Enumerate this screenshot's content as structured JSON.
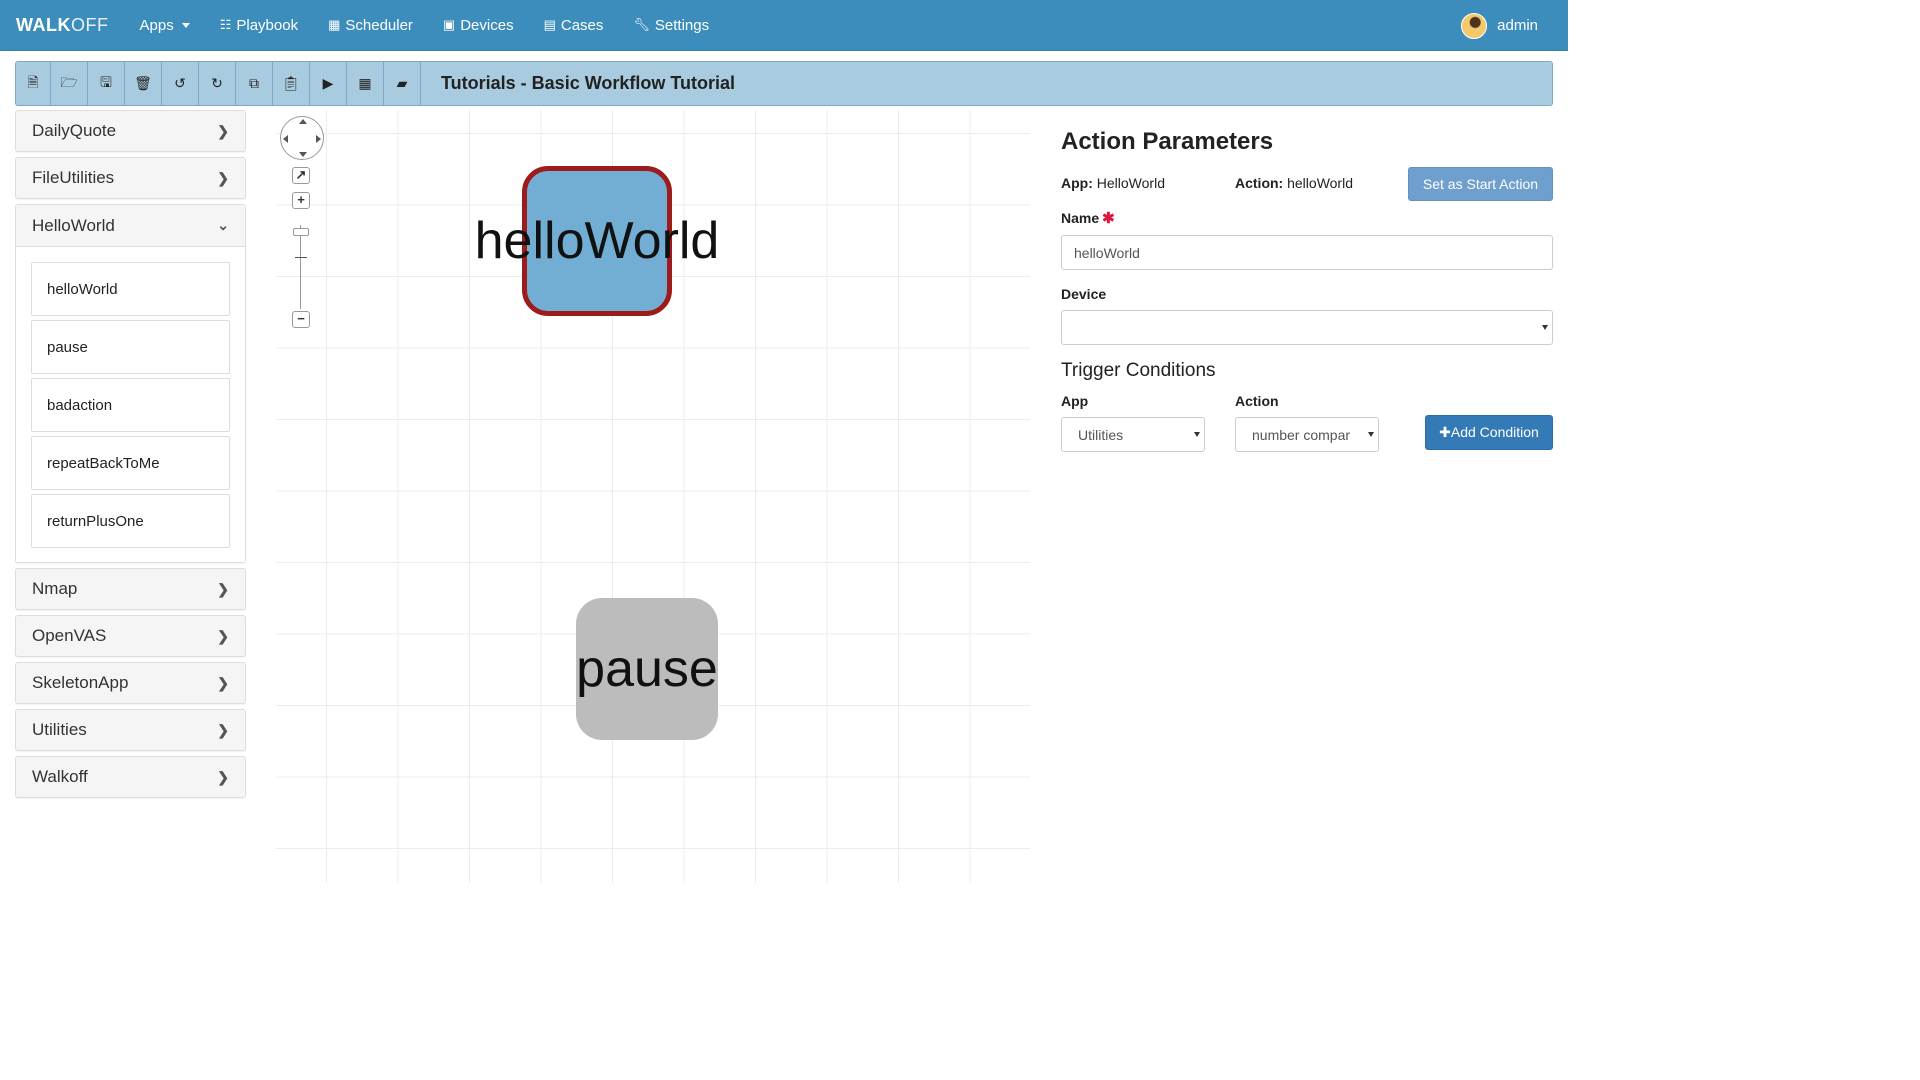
{
  "navbar": {
    "brand_bold": "WALK",
    "brand_light": "OFF",
    "items": [
      {
        "label": "Apps",
        "icon": "none",
        "dropdown": true
      },
      {
        "label": "Playbook",
        "icon": "sitemap-icon"
      },
      {
        "label": "Scheduler",
        "icon": "calendar-icon"
      },
      {
        "label": "Devices",
        "icon": "desktop-icon"
      },
      {
        "label": "Cases",
        "icon": "list-icon"
      },
      {
        "label": "Settings",
        "icon": "wrench-icon"
      }
    ],
    "user": "admin"
  },
  "toolbar": {
    "title": "Tutorials - Basic Workflow Tutorial",
    "buttons": [
      "new-file-icon",
      "open-folder-icon",
      "save-icon",
      "trash-icon",
      "undo-icon",
      "redo-icon",
      "copy-icon",
      "paste-icon",
      "play-icon",
      "table-icon",
      "eraser-icon"
    ]
  },
  "sidebar": {
    "apps": [
      {
        "label": "DailyQuote",
        "open": false
      },
      {
        "label": "FileUtilities",
        "open": false
      },
      {
        "label": "HelloWorld",
        "open": true,
        "actions": [
          "helloWorld",
          "pause",
          "badaction",
          "repeatBackToMe",
          "returnPlusOne"
        ]
      },
      {
        "label": "Nmap",
        "open": false
      },
      {
        "label": "OpenVAS",
        "open": false
      },
      {
        "label": "SkeletonApp",
        "open": false
      },
      {
        "label": "Utilities",
        "open": false
      },
      {
        "label": "Walkoff",
        "open": false
      }
    ]
  },
  "canvas": {
    "nodes": [
      {
        "label": "helloWorld",
        "selected": true,
        "color": "#72aed4",
        "border": "#9e1b1b"
      },
      {
        "label": "pause",
        "selected": false,
        "color": "#bcbcbc"
      }
    ]
  },
  "params": {
    "heading": "Action Parameters",
    "app_label": "App:",
    "app_value": "HelloWorld",
    "action_label": "Action:",
    "action_value": "helloWorld",
    "start_button": "Set as Start Action",
    "name_label": "Name",
    "name_required": "✱",
    "name_value": "helloWorld",
    "device_label": "Device",
    "device_value": "",
    "trigger_title": "Trigger Conditions",
    "trig_app_label": "App",
    "trig_app_value": "Utilities",
    "trig_action_label": "Action",
    "trig_action_value": "number compar",
    "add_button": "✚Add Condition"
  },
  "colors": {
    "navbar": "#3c8dbc",
    "toolbar": "#a9cbe0",
    "primary": "#337ab7",
    "start_button": "#6e9fcd"
  }
}
